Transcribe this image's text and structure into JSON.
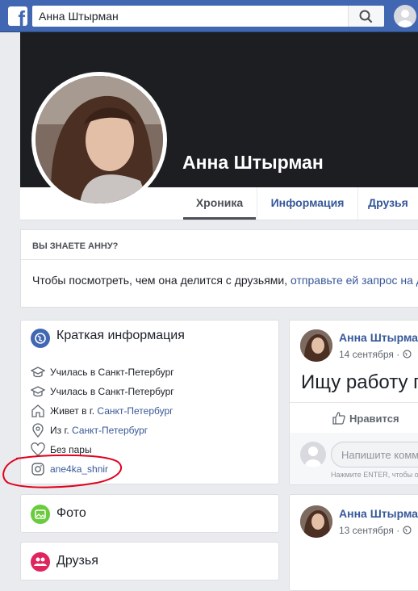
{
  "topbar": {
    "logo": "f",
    "search_value": "Анна Штырман"
  },
  "profile": {
    "name": "Анна Штырман",
    "tabs": [
      "Хроника",
      "Информация",
      "Друзья"
    ]
  },
  "know_box": {
    "heading": "ВЫ ЗНАЕТЕ АННУ?",
    "text": "Чтобы посмотреть, чем она делится с друзьями,",
    "link": "отправьте ей запрос на д"
  },
  "intro": {
    "title": "Краткая информация",
    "rows": [
      {
        "icon": "graduation-cap-icon",
        "text": "Училась в Санкт-Петербург",
        "link": ""
      },
      {
        "icon": "graduation-cap-icon",
        "text": "Училась в Санкт-Петербург",
        "link": ""
      },
      {
        "icon": "home-icon",
        "text": "Живет в г. ",
        "link": "Санкт-Петербург"
      },
      {
        "icon": "location-pin-icon",
        "text": "Из г. ",
        "link": "Санкт-Петербург"
      },
      {
        "icon": "heart-icon",
        "text": "Без пары",
        "link": ""
      },
      {
        "icon": "instagram-icon",
        "text": "",
        "link": "ane4ka_shnir"
      }
    ],
    "annotation_color": "#e1001c"
  },
  "photo_card": {
    "title": "Фото"
  },
  "friends_card": {
    "title": "Друзья"
  },
  "posts": [
    {
      "author": "Анна Штырман",
      "date": "14 сентября · ",
      "text": "Ищу работу п",
      "like_label": "Нравится",
      "comment_placeholder": "Напишите комм",
      "hint": "Нажмите ENTER, чтобы о"
    },
    {
      "author": "Анна Штырман",
      "date": "13 сентября · "
    }
  ],
  "colors": {
    "brand": "#4267b2",
    "link": "#385898"
  }
}
